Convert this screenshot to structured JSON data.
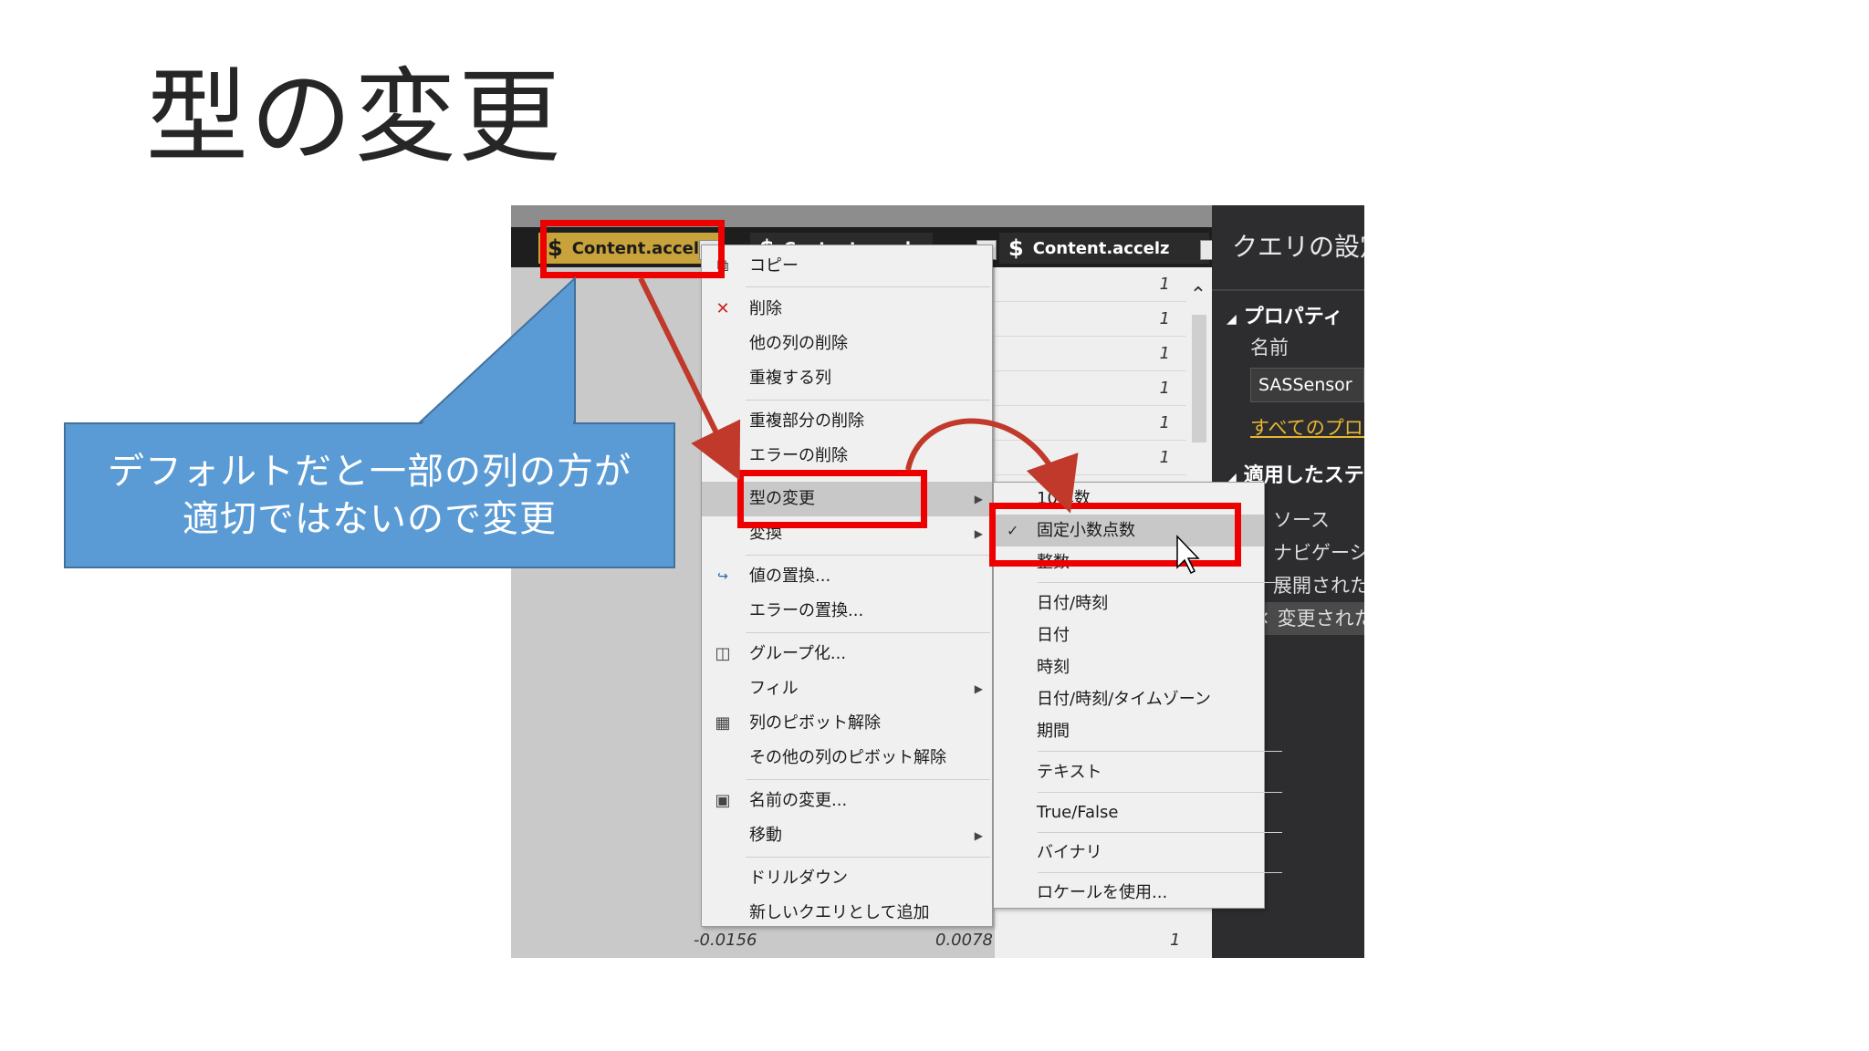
{
  "slide": {
    "title": "型の変更"
  },
  "callout": {
    "line1": "デフォルトだと一部の列の方が",
    "line2": "適切ではないので変更"
  },
  "columns": [
    {
      "name": "Content.accelx",
      "icon": "$"
    },
    {
      "name": "Content.accely",
      "icon": "$"
    },
    {
      "name": "Content.accelz",
      "icon": "$"
    }
  ],
  "cells": {
    "z_values": [
      "1",
      "1",
      "1",
      "1",
      "1",
      "1"
    ],
    "bottom_row": {
      "x": "-0.0156",
      "y": "0.0078",
      "z": "1"
    }
  },
  "context_menu": {
    "items": [
      {
        "label": "コピー",
        "icon": "copy-icon"
      },
      {
        "label": "削除",
        "icon": "delete-icon"
      },
      {
        "label": "他の列の削除"
      },
      {
        "label": "重複する列"
      },
      {
        "label": "重複部分の削除"
      },
      {
        "label": "エラーの削除"
      },
      {
        "label": "型の変更",
        "submenu": true
      },
      {
        "label": "変換",
        "submenu": true
      },
      {
        "label": "値の置換...",
        "icon": "replace-values-icon"
      },
      {
        "label": "エラーの置換..."
      },
      {
        "label": "グループ化...",
        "icon": "group-by-icon"
      },
      {
        "label": "フィル",
        "submenu": true
      },
      {
        "label": "列のピボット解除",
        "icon": "unpivot-icon"
      },
      {
        "label": "その他の列のピボット解除"
      },
      {
        "label": "名前の変更...",
        "icon": "rename-icon"
      },
      {
        "label": "移動",
        "submenu": true
      },
      {
        "label": "ドリルダウン"
      },
      {
        "label": "新しいクエリとして追加"
      }
    ]
  },
  "type_submenu": {
    "items": [
      {
        "label": "10進数"
      },
      {
        "label": "固定小数点数",
        "checked": true
      },
      {
        "label": "整数"
      },
      {
        "label": "日付/時刻"
      },
      {
        "label": "日付"
      },
      {
        "label": "時刻"
      },
      {
        "label": "日付/時刻/タイムゾーン"
      },
      {
        "label": "期間"
      },
      {
        "label": "テキスト"
      },
      {
        "label": "True/False"
      },
      {
        "label": "バイナリ"
      },
      {
        "label": "ロケールを使用..."
      }
    ]
  },
  "query_panel": {
    "title": "クエリの設定",
    "properties_heading": "プロパティ",
    "name_label": "名前",
    "name_value": "SASSensor",
    "all_properties_link": "すべてのプロパティ",
    "steps_heading": "適用したステップ",
    "steps": [
      "ソース",
      "ナビゲーション",
      "展開された",
      "変更された型"
    ]
  },
  "colors": {
    "highlight_red": "#ee0000",
    "callout_blue": "#5b9bd5",
    "header_gold": "#c8a23a",
    "arrow_red": "#c0392b"
  }
}
